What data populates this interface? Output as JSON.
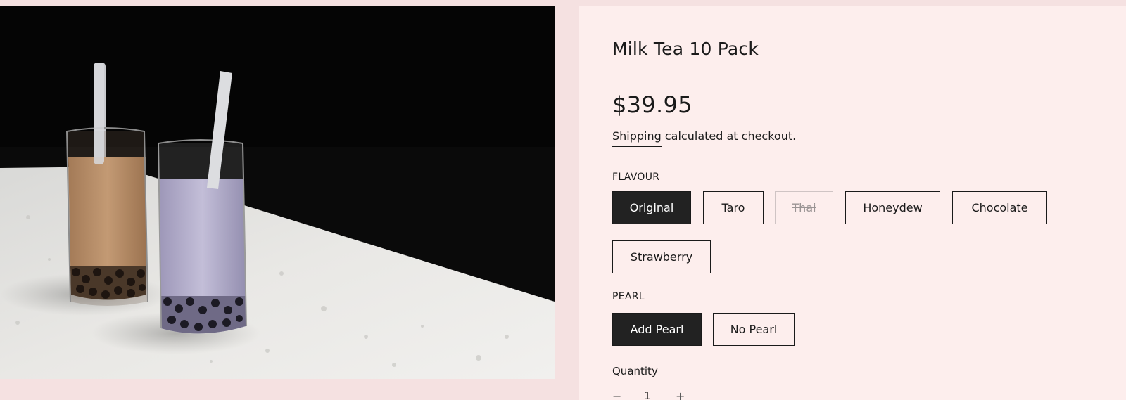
{
  "product": {
    "title": "Milk Tea 10 Pack",
    "price": "$39.95",
    "shipping_link": "Shipping",
    "shipping_rest": " calculated at checkout."
  },
  "flavour": {
    "label": "FLAVOUR",
    "options": [
      {
        "label": "Original",
        "state": "selected"
      },
      {
        "label": "Taro",
        "state": "available"
      },
      {
        "label": "Thai",
        "state": "unavailable"
      },
      {
        "label": "Honeydew",
        "state": "available"
      },
      {
        "label": "Chocolate",
        "state": "available"
      },
      {
        "label": "Strawberry",
        "state": "available"
      }
    ]
  },
  "pearl": {
    "label": "PEARL",
    "options": [
      {
        "label": "Add Pearl",
        "state": "selected"
      },
      {
        "label": "No Pearl",
        "state": "available"
      }
    ]
  },
  "quantity": {
    "label": "Quantity",
    "value": "1",
    "minus_icon": "minus-icon",
    "plus_icon": "plus-icon"
  },
  "colors": {
    "page_bg": "#f5e1e1",
    "panel_bg": "#fdeeed",
    "selected_bg": "#222222",
    "text": "#1a1a1a"
  }
}
